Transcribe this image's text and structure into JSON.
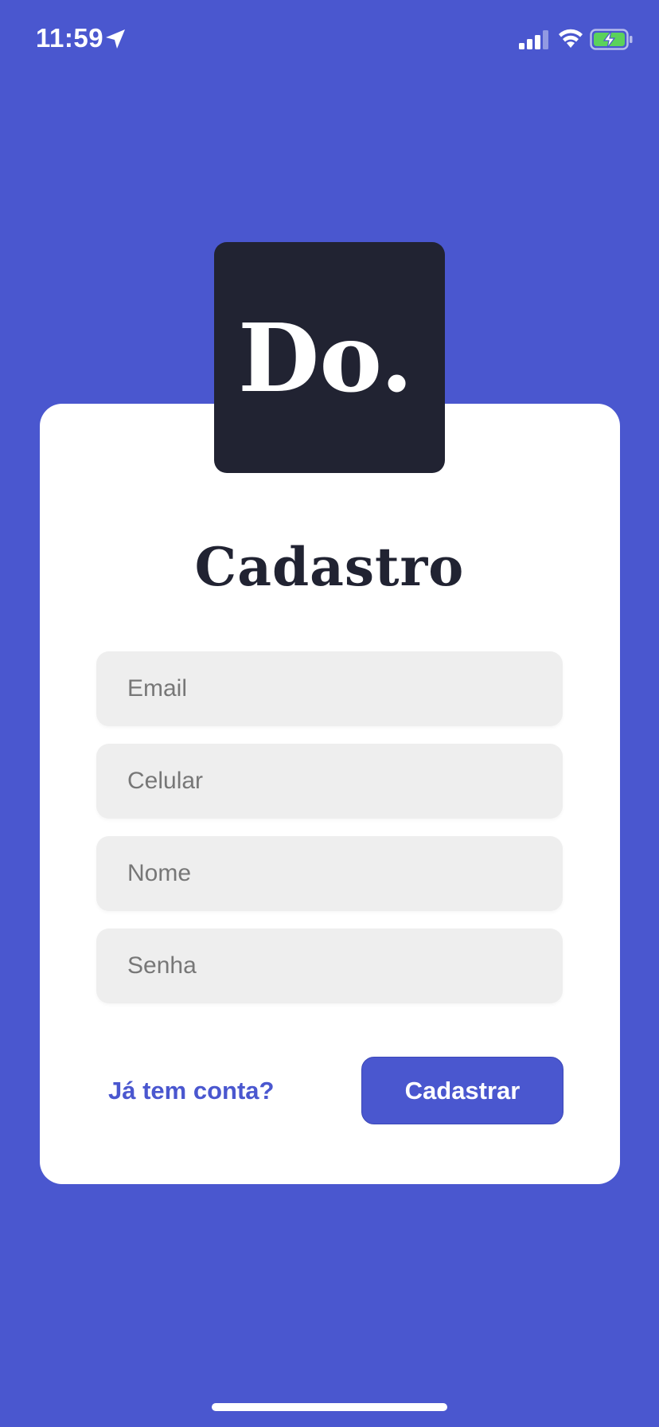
{
  "status_bar": {
    "time": "11:59",
    "icons": [
      "location-arrow-icon",
      "cellular-signal-icon",
      "wifi-icon",
      "battery-charging-icon"
    ]
  },
  "logo": {
    "text": "Do."
  },
  "form": {
    "title": "Cadastro",
    "fields": {
      "email": {
        "placeholder": "Email",
        "value": ""
      },
      "phone": {
        "placeholder": "Celular",
        "value": ""
      },
      "name": {
        "placeholder": "Nome",
        "value": ""
      },
      "password": {
        "placeholder": "Senha",
        "value": ""
      }
    },
    "login_link": "Já tem conta?",
    "submit_label": "Cadastrar"
  },
  "colors": {
    "background": "#4A57CF",
    "card": "#FFFFFF",
    "logo_background": "#212332",
    "input_background": "#EEEEEE",
    "accent": "#4A57CF",
    "battery_fill": "#5BD25A"
  }
}
